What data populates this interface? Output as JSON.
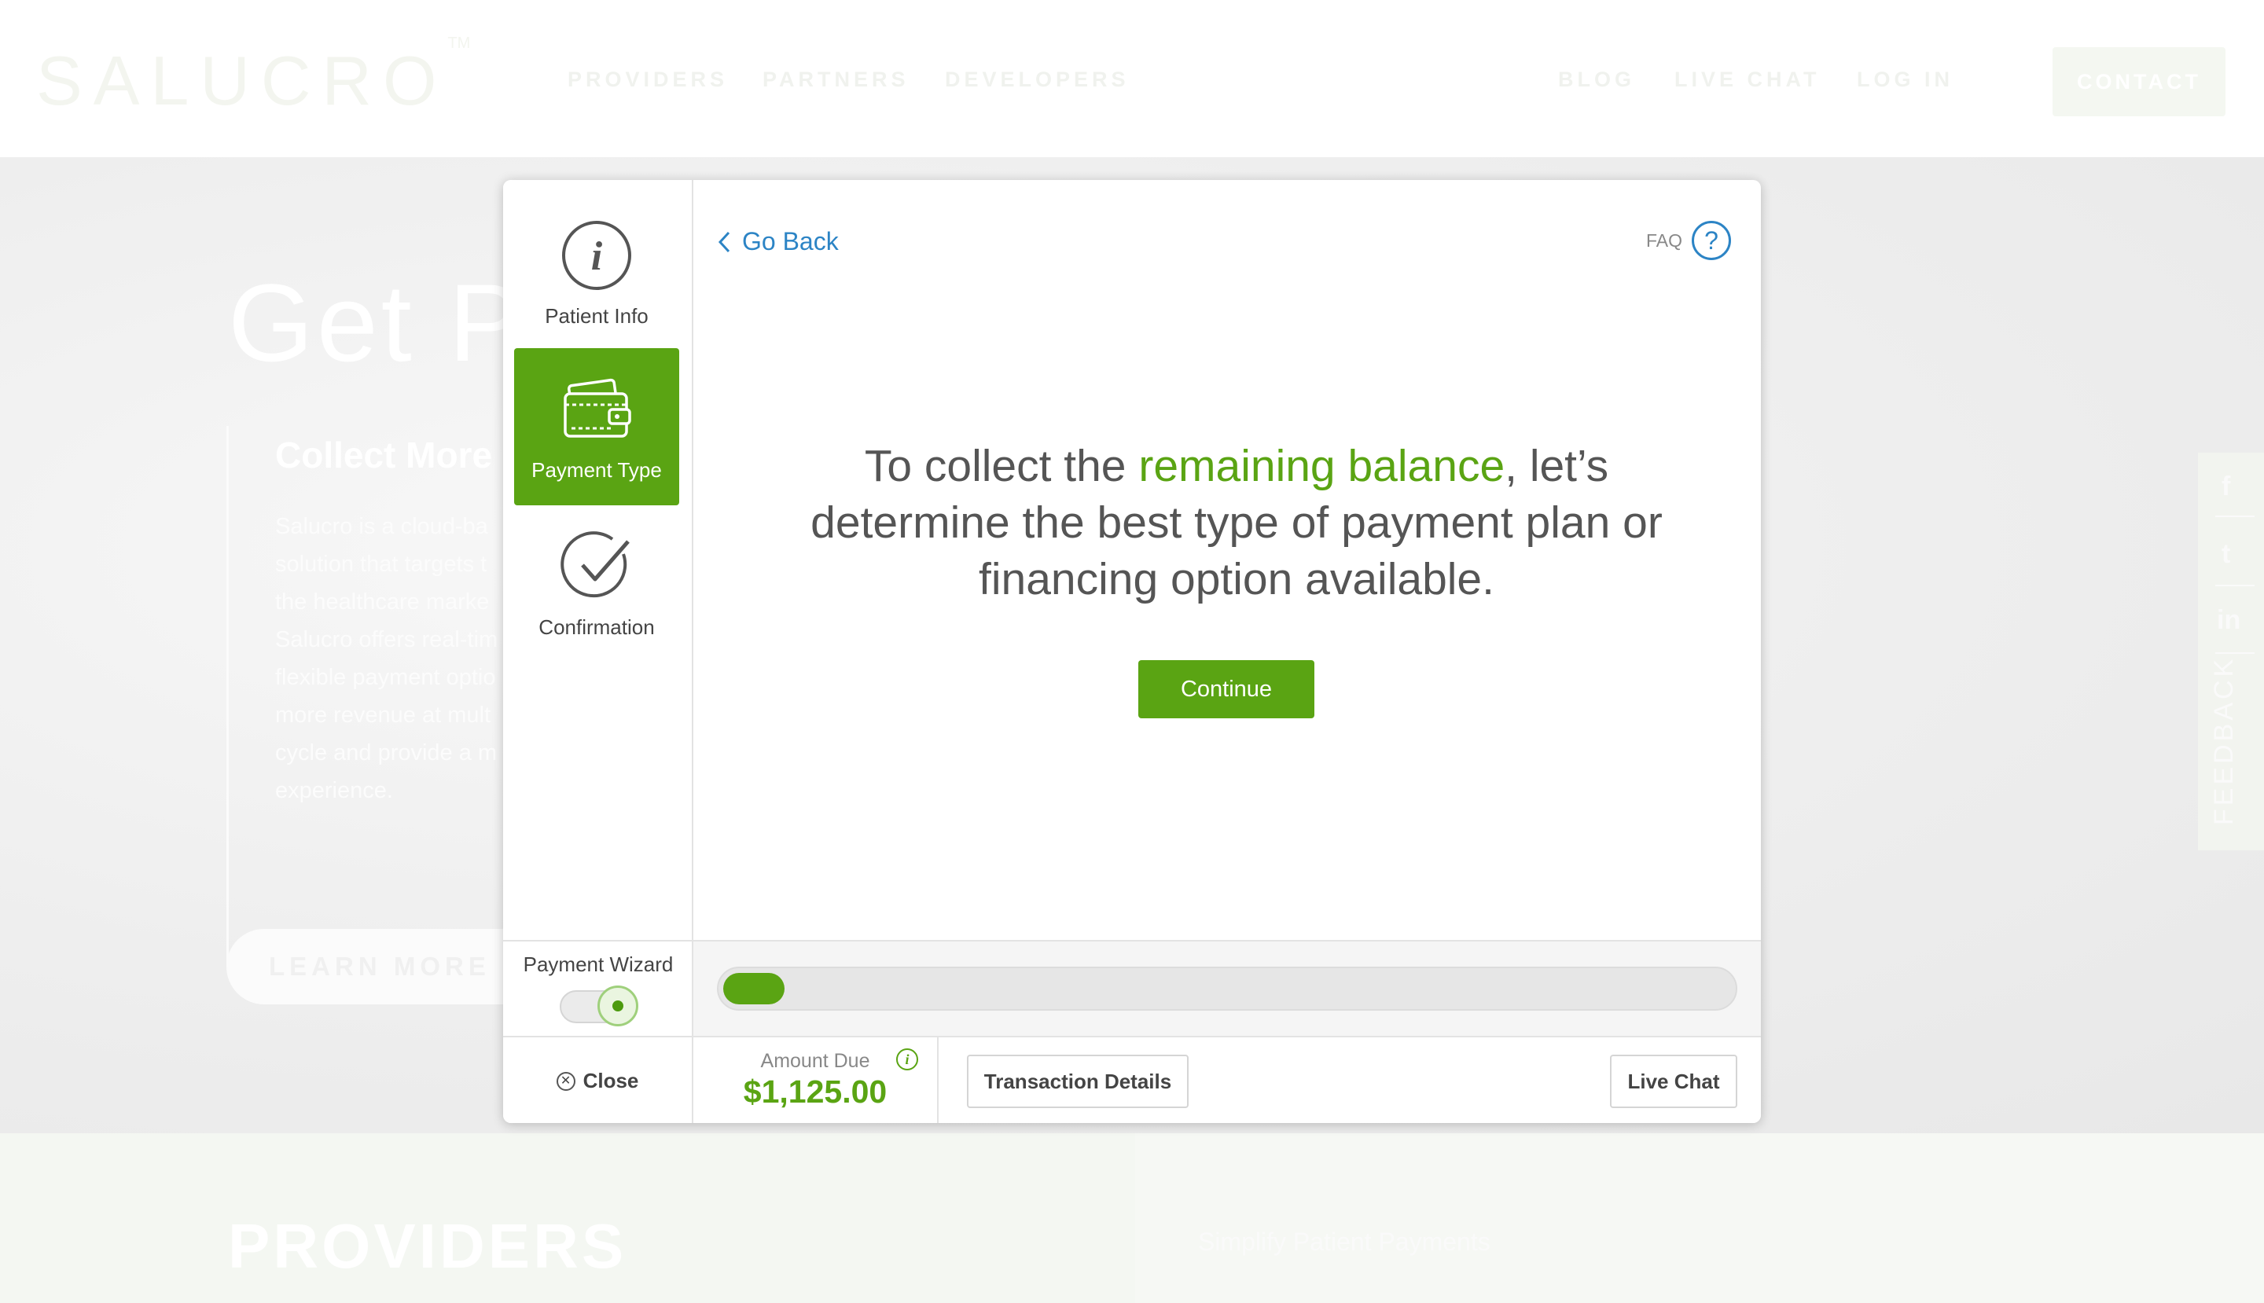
{
  "site": {
    "logo": "SALUCRO",
    "logo_tm": "TM",
    "nav_left": [
      "PROVIDERS",
      "PARTNERS",
      "DEVELOPERS"
    ],
    "nav_right": [
      "BLOG",
      "LIVE CHAT",
      "LOG IN"
    ],
    "contact_label": "CONTACT",
    "hero_title": "Get Pa",
    "hero_subtitle": "Collect More",
    "hero_body": "Salucro is a cloud-ba\nsolution that targets t\nthe healthcare marke\nSalucro offers real-tim\nflexible payment optio\nmore revenue at mult\ncycle and provide a m\nexperience.",
    "learn_more_label": "LEARN MORE",
    "social_icons": [
      "facebook-icon",
      "twitter-icon",
      "linkedin-icon"
    ],
    "social_glyphs": [
      "f",
      "t",
      "in"
    ],
    "feedback_label": "FEEDBACK",
    "providers_title": "PROVIDERS",
    "providers_subtitle": "Simplify Patient Payments"
  },
  "modal": {
    "steps": [
      {
        "label": "Patient Info",
        "icon": "info-icon",
        "active": false
      },
      {
        "label": "Payment Type",
        "icon": "wallet-icon",
        "active": true
      },
      {
        "label": "Confirmation",
        "icon": "checkmark-icon",
        "active": false
      }
    ],
    "go_back_label": "Go Back",
    "faq_label": "FAQ",
    "faq_glyph": "?",
    "headline_pre": "To collect the ",
    "headline_highlight": "remaining balance",
    "headline_post": ", let’s determine the best type of payment plan or financing option available.",
    "continue_label": "Continue",
    "wizard_label": "Payment Wizard",
    "wizard_toggle_on": true,
    "progress_fraction": 0.03,
    "close_label": "Close",
    "amount_due_label": "Amount Due",
    "amount_due_value": "$1,125.00",
    "transaction_details_label": "Transaction Details",
    "live_chat_label": "Live Chat"
  },
  "colors": {
    "accent_green": "#5aa413",
    "link_blue": "#2c84c5",
    "text_gray": "#555555"
  }
}
